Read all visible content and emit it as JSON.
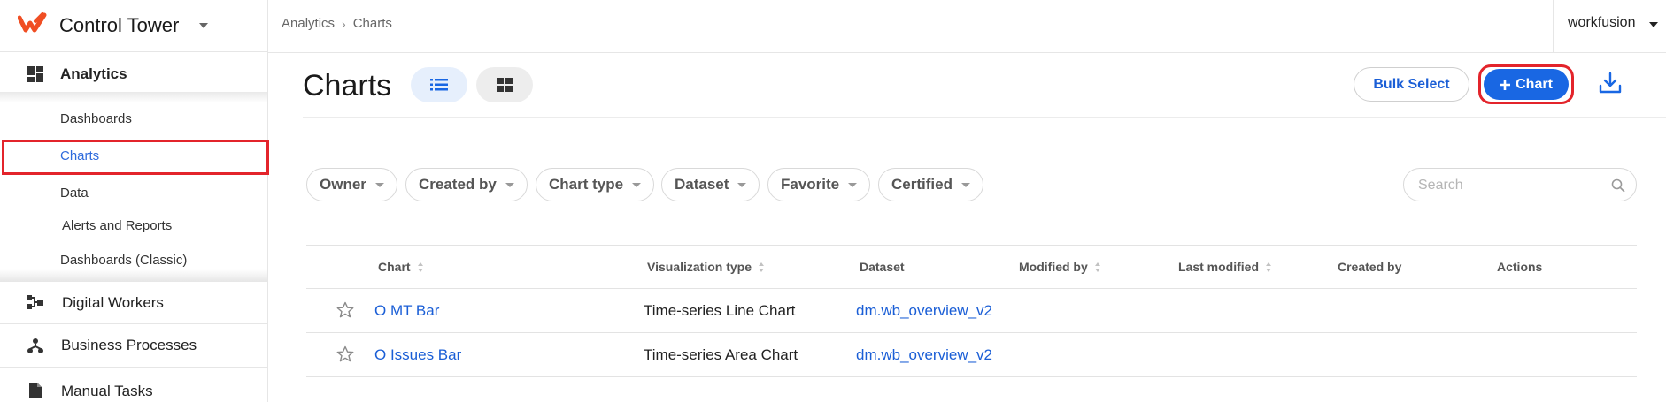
{
  "sidebar": {
    "brand": "Control Tower",
    "sections": {
      "analytics": "Analytics",
      "digital_workers": "Digital Workers",
      "business_processes": "Business Processes",
      "manual_tasks": "Manual Tasks"
    },
    "analytics_items": [
      "Dashboards",
      "Charts",
      "Data",
      "Alerts and Reports",
      "Dashboards (Classic)"
    ],
    "active_item": "Charts"
  },
  "topbar": {
    "breadcrumb": [
      "Analytics",
      "Charts"
    ],
    "user": "workfusion"
  },
  "header": {
    "title": "Charts",
    "bulk_select": "Bulk Select",
    "add_chart": "Chart"
  },
  "filters": [
    "Owner",
    "Created by",
    "Chart type",
    "Dataset",
    "Favorite",
    "Certified"
  ],
  "search": {
    "placeholder": "Search",
    "value": ""
  },
  "table": {
    "columns": [
      "Chart",
      "Visualization type",
      "Dataset",
      "Modified by",
      "Last modified",
      "Created by",
      "Actions"
    ],
    "rows": [
      {
        "chart": "O MT Bar",
        "viz": "Time-series Line Chart",
        "dataset": "dm.wb_overview_v2"
      },
      {
        "chart": "O Issues Bar",
        "viz": "Time-series Area Chart",
        "dataset": "dm.wb_overview_v2"
      }
    ]
  },
  "colors": {
    "accent": "#1967e3",
    "link": "#1a5ed6",
    "highlight": "#e3242b",
    "brand": "#f04e23"
  }
}
